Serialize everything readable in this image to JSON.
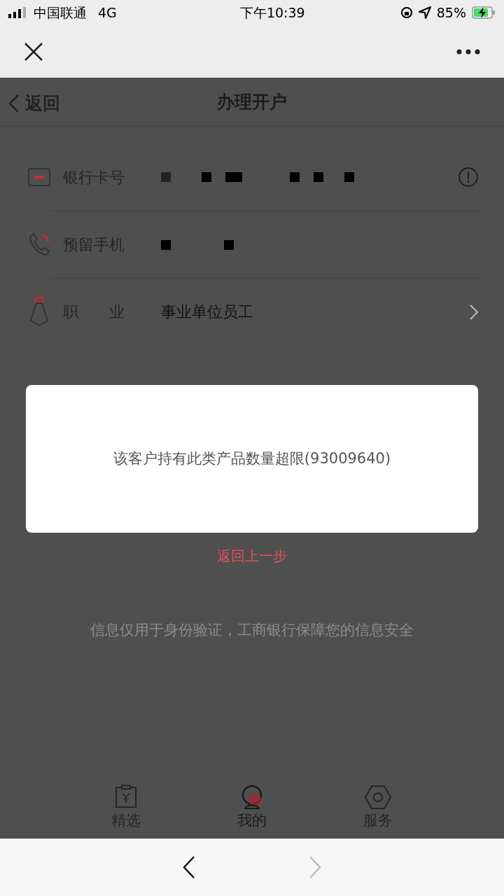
{
  "status_bar": {
    "carrier": "中国联通",
    "network": "4G",
    "time": "下午10:39",
    "battery": "85%",
    "charging": true
  },
  "header": {
    "back": "返回",
    "title": "办理开户"
  },
  "form_rows": [
    {
      "kind": "card",
      "label": "银行卡号",
      "value_redacted": true,
      "info": true
    },
    {
      "kind": "phone",
      "label": "预留手机",
      "value_redacted": true
    },
    {
      "kind": "job",
      "label": "职　　业",
      "value": "事业单位员工",
      "chevron": true
    }
  ],
  "back_link": "返回上一步",
  "note": "信息仅用于身份验证，工商银行保障您的信息安全",
  "dialog": {
    "message": "该客户持有此类产品数量超限(93009640)"
  },
  "tabs": [
    {
      "label": "精选",
      "kind": "receipt",
      "selected": false
    },
    {
      "label": "我的",
      "kind": "avatar",
      "selected": true
    },
    {
      "label": "服务",
      "kind": "hexagon",
      "selected": false
    }
  ],
  "browser_nav": {
    "back_disabled": false,
    "forward_disabled": true
  }
}
